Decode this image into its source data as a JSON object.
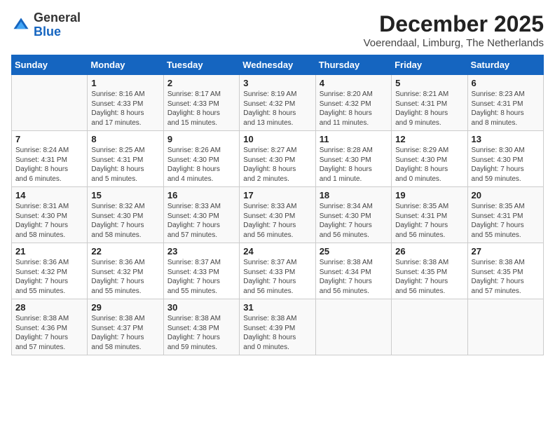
{
  "logo": {
    "general": "General",
    "blue": "Blue"
  },
  "title": "December 2025",
  "subtitle": "Voerendaal, Limburg, The Netherlands",
  "days_of_week": [
    "Sunday",
    "Monday",
    "Tuesday",
    "Wednesday",
    "Thursday",
    "Friday",
    "Saturday"
  ],
  "weeks": [
    [
      {
        "day": "",
        "info": ""
      },
      {
        "day": "1",
        "info": "Sunrise: 8:16 AM\nSunset: 4:33 PM\nDaylight: 8 hours\nand 17 minutes."
      },
      {
        "day": "2",
        "info": "Sunrise: 8:17 AM\nSunset: 4:33 PM\nDaylight: 8 hours\nand 15 minutes."
      },
      {
        "day": "3",
        "info": "Sunrise: 8:19 AM\nSunset: 4:32 PM\nDaylight: 8 hours\nand 13 minutes."
      },
      {
        "day": "4",
        "info": "Sunrise: 8:20 AM\nSunset: 4:32 PM\nDaylight: 8 hours\nand 11 minutes."
      },
      {
        "day": "5",
        "info": "Sunrise: 8:21 AM\nSunset: 4:31 PM\nDaylight: 8 hours\nand 9 minutes."
      },
      {
        "day": "6",
        "info": "Sunrise: 8:23 AM\nSunset: 4:31 PM\nDaylight: 8 hours\nand 8 minutes."
      }
    ],
    [
      {
        "day": "7",
        "info": "Sunrise: 8:24 AM\nSunset: 4:31 PM\nDaylight: 8 hours\nand 6 minutes."
      },
      {
        "day": "8",
        "info": "Sunrise: 8:25 AM\nSunset: 4:31 PM\nDaylight: 8 hours\nand 5 minutes."
      },
      {
        "day": "9",
        "info": "Sunrise: 8:26 AM\nSunset: 4:30 PM\nDaylight: 8 hours\nand 4 minutes."
      },
      {
        "day": "10",
        "info": "Sunrise: 8:27 AM\nSunset: 4:30 PM\nDaylight: 8 hours\nand 2 minutes."
      },
      {
        "day": "11",
        "info": "Sunrise: 8:28 AM\nSunset: 4:30 PM\nDaylight: 8 hours\nand 1 minute."
      },
      {
        "day": "12",
        "info": "Sunrise: 8:29 AM\nSunset: 4:30 PM\nDaylight: 8 hours\nand 0 minutes."
      },
      {
        "day": "13",
        "info": "Sunrise: 8:30 AM\nSunset: 4:30 PM\nDaylight: 7 hours\nand 59 minutes."
      }
    ],
    [
      {
        "day": "14",
        "info": "Sunrise: 8:31 AM\nSunset: 4:30 PM\nDaylight: 7 hours\nand 58 minutes."
      },
      {
        "day": "15",
        "info": "Sunrise: 8:32 AM\nSunset: 4:30 PM\nDaylight: 7 hours\nand 58 minutes."
      },
      {
        "day": "16",
        "info": "Sunrise: 8:33 AM\nSunset: 4:30 PM\nDaylight: 7 hours\nand 57 minutes."
      },
      {
        "day": "17",
        "info": "Sunrise: 8:33 AM\nSunset: 4:30 PM\nDaylight: 7 hours\nand 56 minutes."
      },
      {
        "day": "18",
        "info": "Sunrise: 8:34 AM\nSunset: 4:30 PM\nDaylight: 7 hours\nand 56 minutes."
      },
      {
        "day": "19",
        "info": "Sunrise: 8:35 AM\nSunset: 4:31 PM\nDaylight: 7 hours\nand 56 minutes."
      },
      {
        "day": "20",
        "info": "Sunrise: 8:35 AM\nSunset: 4:31 PM\nDaylight: 7 hours\nand 55 minutes."
      }
    ],
    [
      {
        "day": "21",
        "info": "Sunrise: 8:36 AM\nSunset: 4:32 PM\nDaylight: 7 hours\nand 55 minutes."
      },
      {
        "day": "22",
        "info": "Sunrise: 8:36 AM\nSunset: 4:32 PM\nDaylight: 7 hours\nand 55 minutes."
      },
      {
        "day": "23",
        "info": "Sunrise: 8:37 AM\nSunset: 4:33 PM\nDaylight: 7 hours\nand 55 minutes."
      },
      {
        "day": "24",
        "info": "Sunrise: 8:37 AM\nSunset: 4:33 PM\nDaylight: 7 hours\nand 56 minutes."
      },
      {
        "day": "25",
        "info": "Sunrise: 8:38 AM\nSunset: 4:34 PM\nDaylight: 7 hours\nand 56 minutes."
      },
      {
        "day": "26",
        "info": "Sunrise: 8:38 AM\nSunset: 4:35 PM\nDaylight: 7 hours\nand 56 minutes."
      },
      {
        "day": "27",
        "info": "Sunrise: 8:38 AM\nSunset: 4:35 PM\nDaylight: 7 hours\nand 57 minutes."
      }
    ],
    [
      {
        "day": "28",
        "info": "Sunrise: 8:38 AM\nSunset: 4:36 PM\nDaylight: 7 hours\nand 57 minutes."
      },
      {
        "day": "29",
        "info": "Sunrise: 8:38 AM\nSunset: 4:37 PM\nDaylight: 7 hours\nand 58 minutes."
      },
      {
        "day": "30",
        "info": "Sunrise: 8:38 AM\nSunset: 4:38 PM\nDaylight: 7 hours\nand 59 minutes."
      },
      {
        "day": "31",
        "info": "Sunrise: 8:38 AM\nSunset: 4:39 PM\nDaylight: 8 hours\nand 0 minutes."
      },
      {
        "day": "",
        "info": ""
      },
      {
        "day": "",
        "info": ""
      },
      {
        "day": "",
        "info": ""
      }
    ]
  ]
}
